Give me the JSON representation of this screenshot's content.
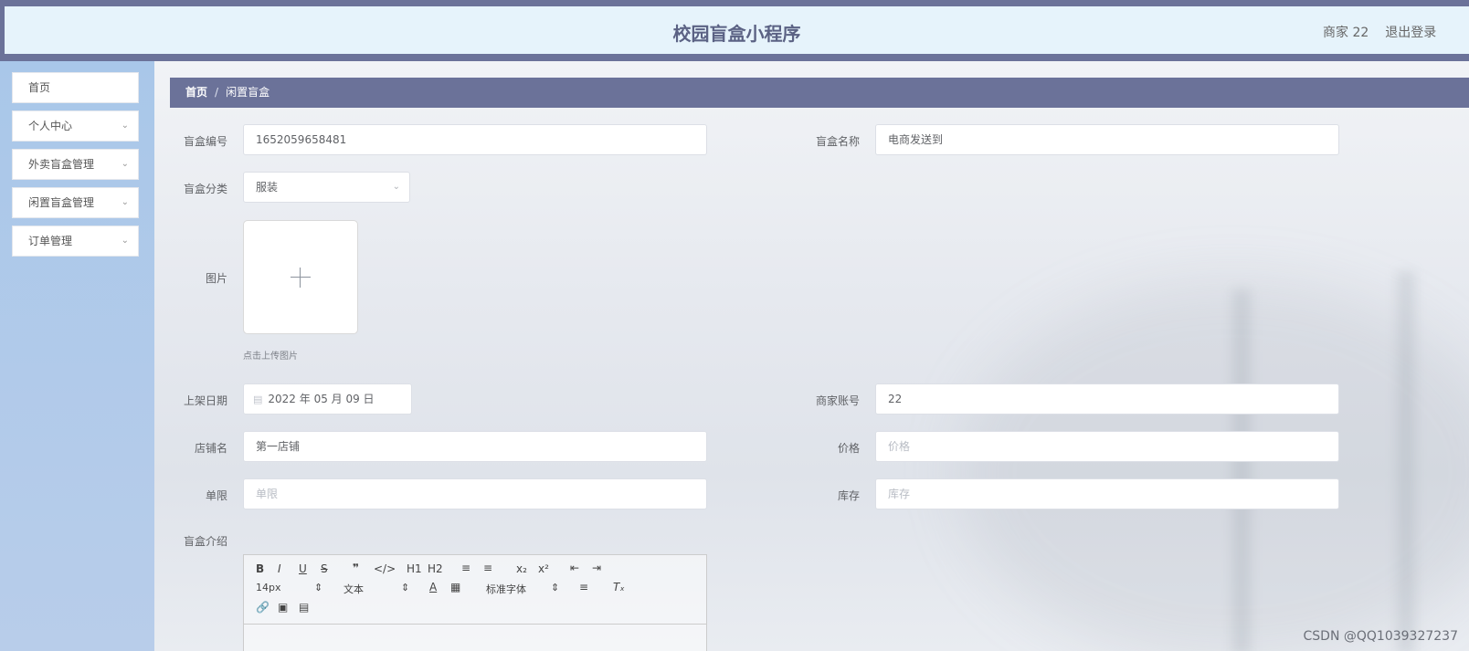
{
  "header": {
    "title": "校园盲盒小程序",
    "user": "商家 22",
    "logout": "退出登录"
  },
  "sidebar": {
    "items": [
      {
        "label": "首页",
        "has_children": false
      },
      {
        "label": "个人中心",
        "has_children": true
      },
      {
        "label": "外卖盲盒管理",
        "has_children": true
      },
      {
        "label": "闲置盲盒管理",
        "has_children": true
      },
      {
        "label": "订单管理",
        "has_children": true
      }
    ]
  },
  "breadcrumb": {
    "home": "首页",
    "separator": "/",
    "current": "闲置盲盒"
  },
  "form": {
    "box_no": {
      "label": "盲盒编号",
      "value": "1652059658481"
    },
    "box_name": {
      "label": "盲盒名称",
      "value": "电商发送到"
    },
    "category": {
      "label": "盲盒分类",
      "value": "服装"
    },
    "image": {
      "label": "图片",
      "tip": "点击上传图片"
    },
    "list_date": {
      "label": "上架日期",
      "value": "2022 年 05 月 09 日"
    },
    "merchant_account": {
      "label": "商家账号",
      "value": "22"
    },
    "shop_name": {
      "label": "店铺名",
      "value": "第一店铺"
    },
    "price": {
      "label": "价格",
      "placeholder": "价格"
    },
    "limit": {
      "label": "单限",
      "placeholder": "单限"
    },
    "stock": {
      "label": "库存",
      "placeholder": "库存"
    },
    "intro": {
      "label": "盲盒介绍"
    }
  },
  "editor": {
    "font_size": "14px",
    "paragraph": "文本",
    "font_family": "标准字体",
    "h1": "H1",
    "h2": "H2"
  },
  "watermark": "CSDN @QQ1039327237",
  "colors": {
    "accent": "#6b7299",
    "header_bg": "#e6f3fb"
  }
}
